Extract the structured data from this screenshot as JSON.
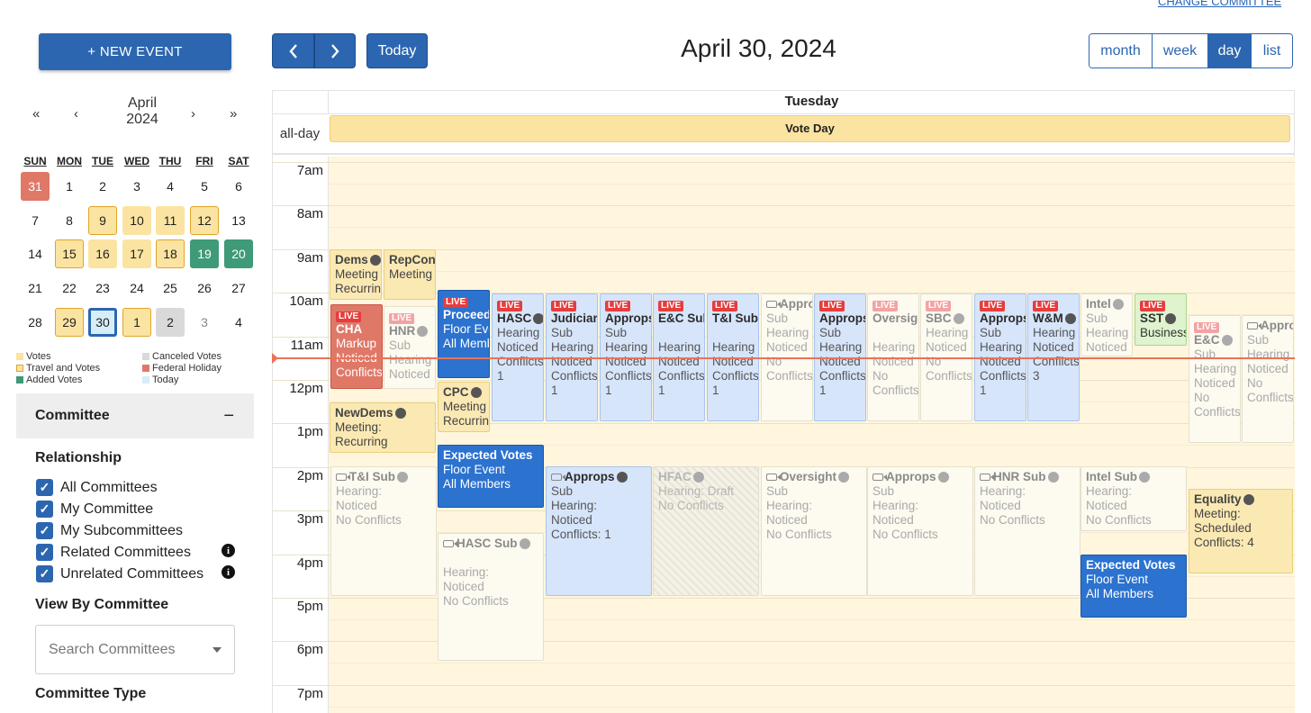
{
  "header": {
    "change_committee": "CHANGE COMMITTEE",
    "new_event": "+ NEW EVENT",
    "today": "Today",
    "date_title": "April 30, 2024",
    "views": [
      "month",
      "week",
      "day",
      "list"
    ],
    "active_view": "day"
  },
  "mini_calendar": {
    "month": "April",
    "year": "2024",
    "nav": {
      "prev_year": "«",
      "prev_month": "‹",
      "next_month": "›",
      "next_year": "»"
    },
    "dow": [
      "SUN",
      "MON",
      "TUE",
      "WED",
      "THU",
      "FRI",
      "SAT"
    ],
    "weeks": [
      [
        "31",
        "1",
        "2",
        "3",
        "4",
        "5",
        "6"
      ],
      [
        "7",
        "8",
        "9",
        "10",
        "11",
        "12",
        "13"
      ],
      [
        "14",
        "15",
        "16",
        "17",
        "18",
        "19",
        "20"
      ],
      [
        "21",
        "22",
        "23",
        "24",
        "25",
        "26",
        "27"
      ],
      [
        "28",
        "29",
        "30",
        "1",
        "2",
        "3",
        "4"
      ]
    ],
    "legend": [
      {
        "label": "Votes",
        "color": "#fbe3a1"
      },
      {
        "label": "Canceled Votes",
        "color": "#d9d9d9"
      },
      {
        "label": "Travel and Votes",
        "color": "#fbe3a1"
      },
      {
        "label": "Federal Holiday",
        "color": "#e07868"
      },
      {
        "label": "Added Votes",
        "color": "#3f9a78"
      },
      {
        "label": "Today",
        "color": "#d6eef7"
      }
    ]
  },
  "committee_panel": {
    "title": "Committee",
    "collapse_symbol": "−",
    "relationship_title": "Relationship",
    "checkboxes": [
      "All Committees",
      "My Committee",
      "My Subcommittees",
      "Related Committees",
      "Unrelated Committees"
    ],
    "view_by_title": "View By Committee",
    "search_placeholder": "Search Committees",
    "type_title": "Committee Type"
  },
  "calendar": {
    "day_name": "Tuesday",
    "all_day_label": "all-day",
    "all_day_event": "Vote Day",
    "times": [
      "7am",
      "8am",
      "9am",
      "10am",
      "11am",
      "12pm",
      "1pm",
      "2pm",
      "3pm",
      "4pm",
      "5pm",
      "6pm",
      "7pm"
    ],
    "events": [
      {
        "id": "dems",
        "lines": [
          "Dems",
          "Meeting",
          "Recurring"
        ]
      },
      {
        "id": "repcon",
        "lines": [
          "RepCon",
          "Meeting"
        ]
      },
      {
        "id": "cha",
        "live": "LIVE",
        "lines": [
          "CHA",
          "Markup",
          "Noticed",
          "Conflicts"
        ]
      },
      {
        "id": "hnr1",
        "live": "LIVE",
        "lines": [
          "HNR",
          "Sub",
          "Hearing",
          "Noticed"
        ]
      },
      {
        "id": "proceed",
        "live": "LIVE",
        "lines": [
          "Proceedings",
          "Floor Event",
          "All Members"
        ]
      },
      {
        "id": "hasc",
        "live": "LIVE",
        "lines": [
          "HASC",
          "Hearing",
          "Noticed",
          "Conflicts:",
          "1"
        ]
      },
      {
        "id": "judiciary",
        "live": "LIVE",
        "lines": [
          "Judiciary",
          "Sub",
          "Hearing",
          "Noticed",
          "Conflicts:",
          "1"
        ]
      },
      {
        "id": "approps1",
        "live": "LIVE",
        "lines": [
          "Approps",
          "Sub",
          "Hearing",
          "Noticed",
          "Conflicts:",
          "1"
        ]
      },
      {
        "id": "ec1",
        "live": "LIVE",
        "lines": [
          "E&C Sub",
          "",
          "Hearing",
          "Noticed",
          "Conflicts:",
          "1"
        ]
      },
      {
        "id": "ti1",
        "live": "LIVE",
        "lines": [
          "T&I Sub",
          "",
          "Hearing",
          "Noticed",
          "Conflicts:",
          "1"
        ]
      },
      {
        "id": "approps2",
        "lines": [
          "Approps",
          "Sub",
          "Hearing",
          "Noticed",
          "No",
          "Conflicts"
        ]
      },
      {
        "id": "approps3",
        "live": "LIVE",
        "lines": [
          "Approps",
          "Sub",
          "Hearing",
          "Noticed",
          "Conflicts:",
          "1"
        ]
      },
      {
        "id": "oversight1",
        "live": "LIVE",
        "lines": [
          "Oversight",
          "",
          "Hearing",
          "Noticed",
          "No",
          "Conflicts"
        ]
      },
      {
        "id": "sbc",
        "live": "LIVE",
        "lines": [
          "SBC",
          "Hearing",
          "Noticed",
          "No",
          "Conflicts"
        ]
      },
      {
        "id": "approps4",
        "live": "LIVE",
        "lines": [
          "Approps",
          "Sub",
          "Hearing",
          "Noticed",
          "Conflicts:",
          "1"
        ]
      },
      {
        "id": "wm",
        "live": "LIVE",
        "lines": [
          "W&M",
          "Hearing",
          "Noticed",
          "Conflicts:",
          "3"
        ]
      },
      {
        "id": "intel1",
        "lines": [
          "Intel",
          "Sub",
          "Hearing",
          "Noticed"
        ]
      },
      {
        "id": "sst",
        "live": "LIVE",
        "lines": [
          "SST",
          "Business"
        ]
      },
      {
        "id": "ec2",
        "live": "LIVE",
        "lines": [
          "E&C",
          "Sub",
          "Hearing",
          "Noticed",
          "No",
          "Conflicts"
        ]
      },
      {
        "id": "approps5",
        "lines": [
          "Approps",
          "Sub",
          "Hearing",
          "Noticed",
          "No",
          "Conflicts"
        ]
      },
      {
        "id": "cpc",
        "lines": [
          "CPC",
          "Meeting",
          "Recurring"
        ]
      },
      {
        "id": "newdems",
        "lines": [
          "NewDems",
          "Meeting:",
          "Recurring"
        ]
      },
      {
        "id": "expected1",
        "lines": [
          "Expected Votes",
          "Floor Event",
          "All Members"
        ]
      },
      {
        "id": "ti2",
        "lines": [
          "T&I Sub",
          "Hearing:",
          "Noticed",
          "No Conflicts"
        ]
      },
      {
        "id": "hasc2",
        "lines": [
          "HASC Sub",
          "",
          "Hearing:",
          "Noticed",
          "No Conflicts"
        ]
      },
      {
        "id": "approps6",
        "lines": [
          "Approps",
          "Sub",
          "Hearing:",
          "Noticed",
          "Conflicts: 1"
        ]
      },
      {
        "id": "hfac",
        "lines": [
          "HFAC",
          "Hearing: Draft",
          "No Conflicts"
        ]
      },
      {
        "id": "oversight2",
        "lines": [
          "Oversight",
          "Sub",
          "Hearing:",
          "Noticed",
          "No Conflicts"
        ]
      },
      {
        "id": "approps7",
        "lines": [
          "Approps",
          "Sub",
          "Hearing:",
          "Noticed",
          "No Conflicts"
        ]
      },
      {
        "id": "hnr2",
        "lines": [
          "HNR Sub",
          "Hearing:",
          "Noticed",
          "No Conflicts"
        ]
      },
      {
        "id": "intel2",
        "lines": [
          "Intel Sub",
          "Hearing:",
          "Noticed",
          "No Conflicts"
        ]
      },
      {
        "id": "equality",
        "lines": [
          "Equality",
          "Meeting:",
          "Scheduled",
          "Conflicts: 4"
        ]
      },
      {
        "id": "expected2",
        "lines": [
          "Expected Votes",
          "Floor Event",
          "All Members"
        ]
      }
    ]
  }
}
